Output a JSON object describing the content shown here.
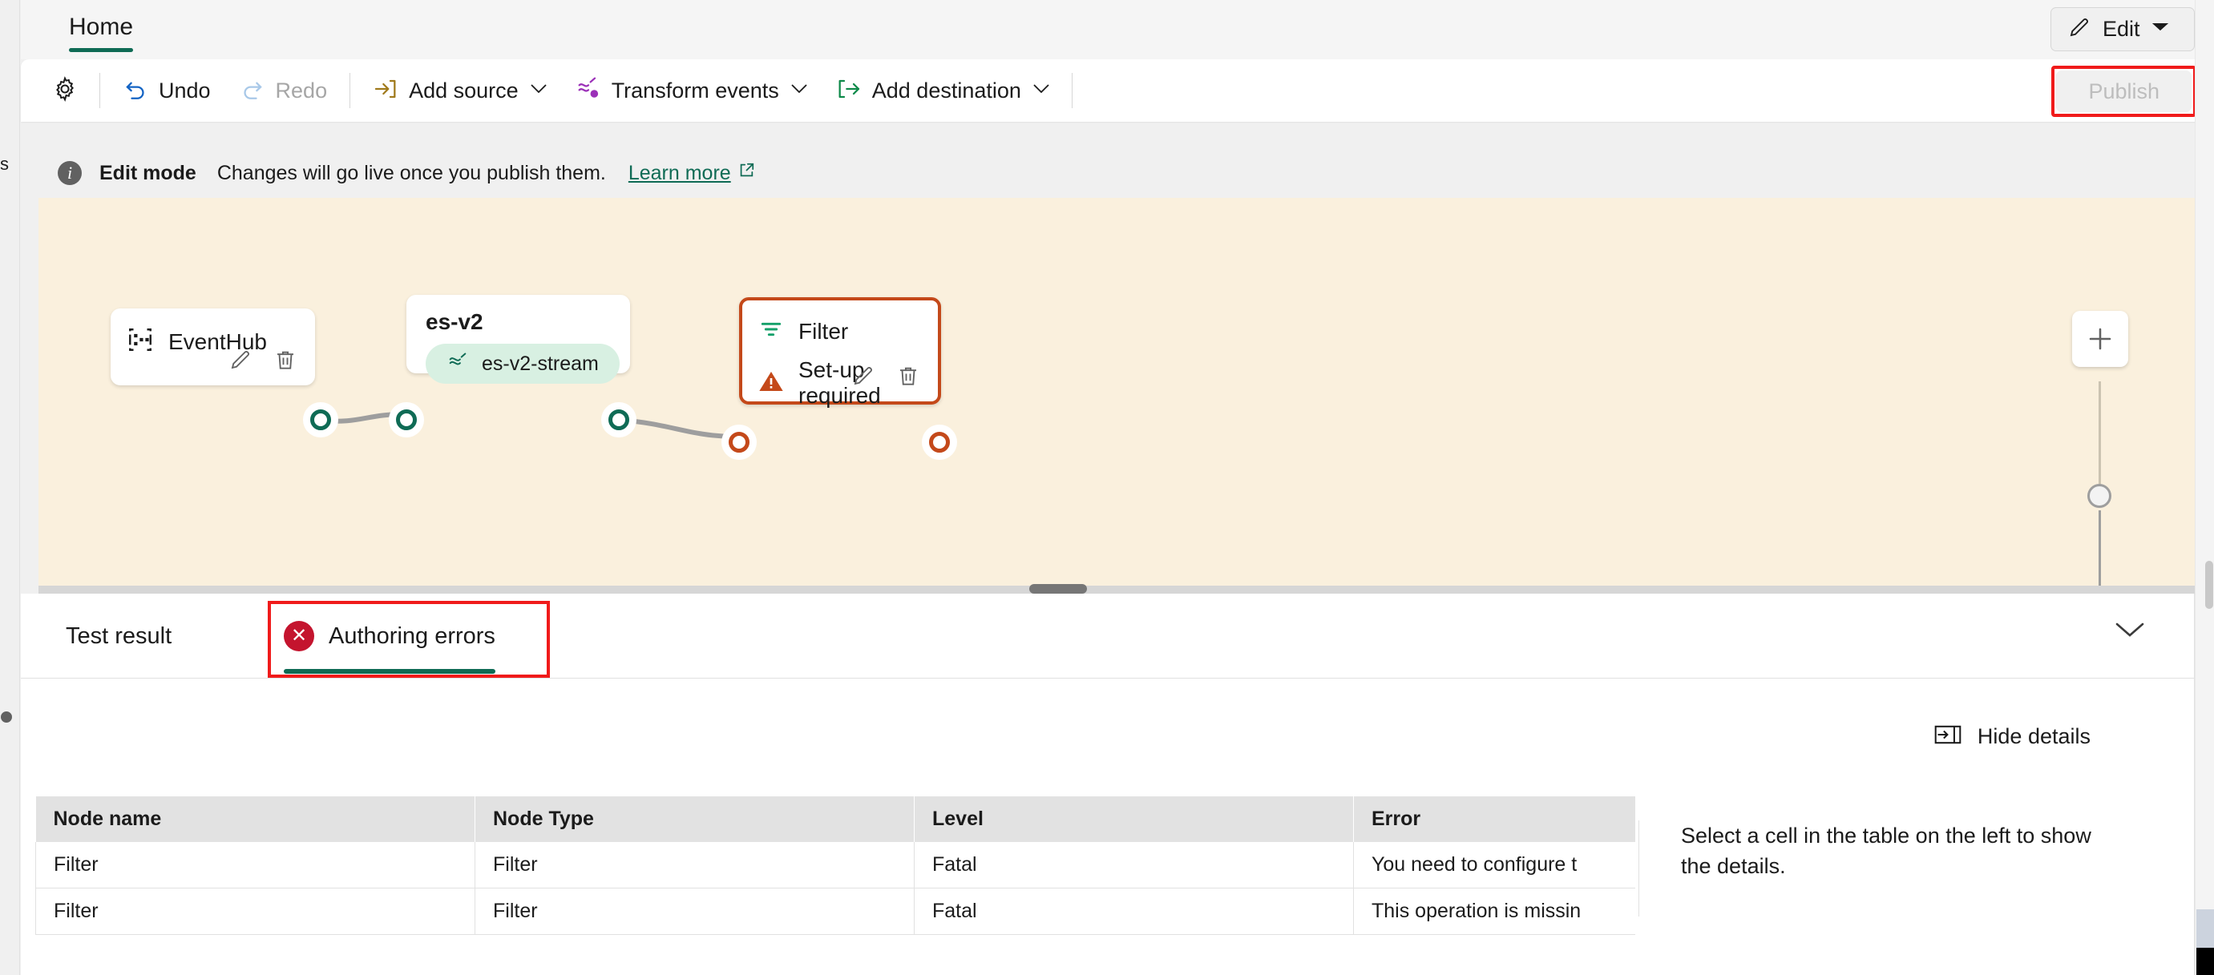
{
  "left_rail": {
    "clipped_label": "s"
  },
  "ribbon": {
    "tab_label": "Home",
    "edit_button": {
      "label": "Edit",
      "icon": "pencil-icon",
      "chevron": "chevron-down-icon"
    },
    "accent_color": "#0f6b55"
  },
  "commandbar": {
    "settings_icon": "gear-icon",
    "items": [
      {
        "label": "Undo",
        "icon": "undo-icon",
        "enabled": true
      },
      {
        "label": "Redo",
        "icon": "redo-icon",
        "enabled": false
      },
      {
        "label": "Add source",
        "icon": "add-source-icon",
        "enabled": true,
        "has_chevron": true
      },
      {
        "label": "Transform events",
        "icon": "transform-events-icon",
        "enabled": true,
        "has_chevron": true
      },
      {
        "label": "Add destination",
        "icon": "add-destination-icon",
        "enabled": true,
        "has_chevron": true
      }
    ],
    "publish": {
      "label": "Publish",
      "enabled": false,
      "highlight_color": "#f01b1b"
    }
  },
  "editbar": {
    "icon": "info-icon",
    "title": "Edit mode",
    "message": "Changes will go live once you publish them.",
    "link_label": "Learn more",
    "link_icon": "external-link-icon"
  },
  "canvas": {
    "background_color": "#faf0dd",
    "nodes": [
      {
        "id": "eventhub",
        "title": "EventHub",
        "icon": "eventhub-icon",
        "has_edit": true,
        "has_delete": true
      },
      {
        "id": "es-v2",
        "title": "es-v2",
        "chip_label": "es-v2-stream",
        "chip_icon": "stream-icon"
      },
      {
        "id": "filter",
        "title": "Filter",
        "icon": "filter-icon",
        "status": "Set-up required",
        "status_icon": "warning-icon",
        "has_edit": true,
        "has_delete": true,
        "error_color": "#c4491a"
      }
    ],
    "zoom_controls": {
      "plus_label": "+",
      "plus_icon": "zoom-in-icon",
      "slider": "zoom-slider"
    }
  },
  "bottom_panel": {
    "tabs": [
      {
        "label": "Test result",
        "selected": false,
        "has_error_icon": false
      },
      {
        "label": "Authoring errors",
        "selected": true,
        "has_error_icon": true,
        "error_icon": "error-circle-icon",
        "highlighted": true
      }
    ],
    "collapse_icon": "chevron-down-icon",
    "hide_details": {
      "label": "Hide details",
      "icon": "hide-details-icon"
    },
    "table": {
      "columns": [
        "Node name",
        "Node Type",
        "Level",
        "Error"
      ],
      "rows": [
        [
          "Filter",
          "Filter",
          "Fatal",
          "You need to configure t"
        ],
        [
          "Filter",
          "Filter",
          "Fatal",
          "This operation is missin"
        ]
      ]
    },
    "details": {
      "text": "Select a cell in the table on the left to show the details."
    }
  }
}
